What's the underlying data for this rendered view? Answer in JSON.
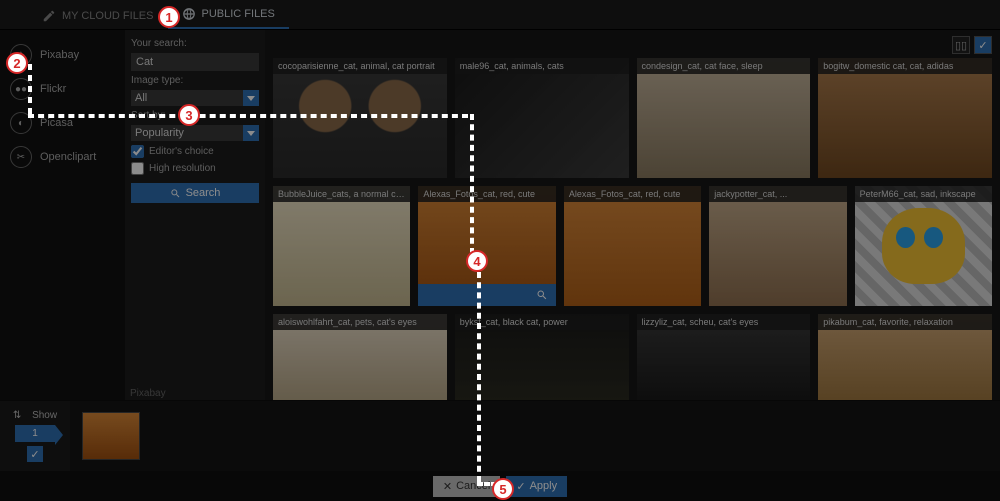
{
  "tabs": {
    "my_cloud": "MY CLOUD FILES",
    "public": "PUBLIC FILES"
  },
  "sources": [
    "Pixabay",
    "Flickr",
    "Picasa",
    "Openclipart"
  ],
  "search": {
    "your_search_label": "Your search:",
    "query": "Cat",
    "image_type_label": "Image type:",
    "image_type_value": "All",
    "sort_by_label": "Sort by:",
    "sort_by_value": "Popularity",
    "editors_choice": "Editor's choice",
    "high_resolution": "High resolution",
    "search_btn": "Search"
  },
  "provider_label": "Pixabay",
  "results": [
    {
      "cap": "cocoparisienne_cat, animal, cat portrait",
      "cls": "cat1"
    },
    {
      "cap": "male96_cat, animals, cats",
      "cls": "cat2"
    },
    {
      "cap": "condesign_cat, cat face, sleep",
      "cls": "cat3"
    },
    {
      "cap": "bogitw_domestic cat, cat, adidas",
      "cls": "cat4"
    },
    {
      "cap": "BubbleJuice_cats, a normal cat, pet",
      "cls": "cat5"
    },
    {
      "cap": "Alexas_Fotos_cat, red, cute",
      "cls": "cat6",
      "selected": true
    },
    {
      "cap": "Alexas_Fotos_cat, red, cute",
      "cls": "cat7"
    },
    {
      "cap": "jackypotter_cat, ...",
      "cls": "cat8"
    },
    {
      "cap": "PeterM66_cat, sad, inkscape",
      "cls": "cat9 cartoon"
    },
    {
      "cap": "aloiswohlfahrt_cat, pets, cat's eyes",
      "cls": "cat10"
    },
    {
      "cap": "bykst_cat, black cat, power",
      "cls": "cat11"
    },
    {
      "cap": "lizzyliz_cat, scheu, cat's eyes",
      "cls": "cat12"
    },
    {
      "cap": "pikabum_cat, favorite, relaxation",
      "cls": "cat13"
    }
  ],
  "tray": {
    "show": "Show",
    "count": "1"
  },
  "footer": {
    "cancel": "Cancel",
    "apply": "Apply"
  },
  "markers": [
    "1",
    "2",
    "3",
    "4",
    "5"
  ]
}
